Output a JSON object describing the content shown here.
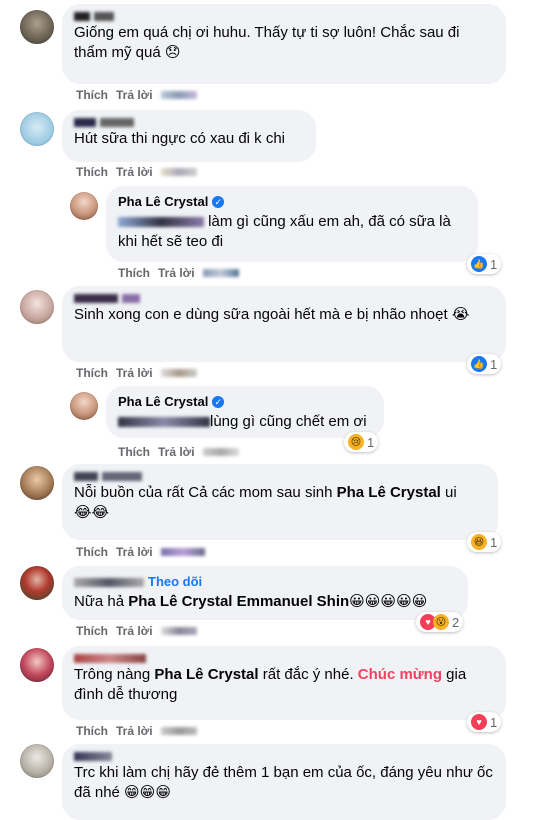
{
  "actions": {
    "like": "Thích",
    "reply": "Trả lời"
  },
  "comments": [
    {
      "text": "Giống em quá chị ơi huhu. Thấy tự ti sợ luôn! Chắc sau đi thẩm mỹ quá 😞"
    },
    {
      "text": "Hút sữa thi ngực có xau đi k chi"
    },
    {
      "author": "Pha Lê Crystal",
      "text": "làm gì cũng xấu em ah, đã có sữa là khi hết sẽ teo đi",
      "reaction_count": "1"
    },
    {
      "text": "Sinh xong con e dùng sữa ngoài hết mà e bị nhão nhoẹt 😭",
      "reaction_count": "1"
    },
    {
      "author": "Pha Lê Crystal",
      "text": "lùng gì cũng chết em ơi",
      "reaction_count": "1"
    },
    {
      "text_before": "Nỗi buồn của rất Cả các mom sau sinh ",
      "mention": "Pha Lê Crystal",
      "text_after": " ui",
      "emoji": "😂😂",
      "reaction_count": "1"
    },
    {
      "follow": "Theo dõi",
      "text_before": "Nữa hả ",
      "mention": "Pha Lê Crystal Emmanuel Shin",
      "emoji": "😀😀😀😀😀",
      "reaction_count": "2"
    },
    {
      "text_before": "Trông nàng ",
      "mention": "Pha Lê Crystal",
      "text_mid": " rất đắc ý nhé. ",
      "highlight": "Chúc mừng",
      "text_after": " gia đình dễ thương",
      "reaction_count": "1"
    },
    {
      "text": "Trc khi làm chị hãy đẻ thêm 1 bạn em của ốc, đáng yêu như ốc đã nhé 😁😁😁"
    }
  ]
}
